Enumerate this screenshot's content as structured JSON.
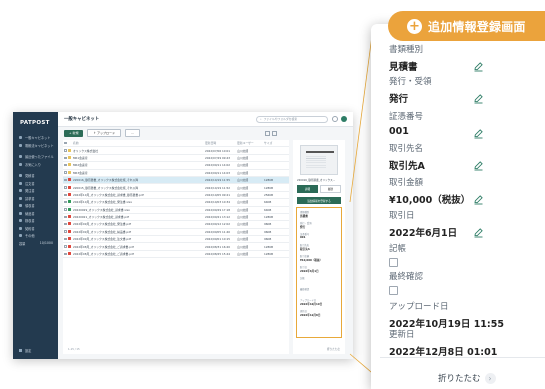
{
  "colors": {
    "accent": "#eba33c",
    "brand": "#2b6b57",
    "sidebar": "#233a4f",
    "selected_row": "#d7ebf5"
  },
  "app": {
    "logo": "PATPOST",
    "page_title": "一般キャビネット",
    "search_placeholder": "ファイルやフォルダを検索",
    "new_button": "新規",
    "upload_button": "アップロード",
    "sidebar": {
      "items": [
        "一般キャビネット",
        "電帳法キャビネット"
      ],
      "section_items": [
        "最近使ったファイル",
        "お気に入り"
      ],
      "categories": [
        "見積書",
        "注文書",
        "発注書",
        "請求書",
        "領収書",
        "納品書",
        "検収書",
        "契約書",
        "その他"
      ],
      "storage_label": "容量",
      "storage_value": "10/1000",
      "bottom": "設定"
    },
    "columns": [
      "名前",
      "更新日時",
      "更新ユーザー",
      "サイズ"
    ],
    "rows": [
      {
        "icon": "folder",
        "name": "オリックス株式会社",
        "date": "2022/07/06 10:01",
        "user": "山川太郎",
        "size": ""
      },
      {
        "icon": "folder",
        "name": "MR1会議室",
        "date": "2022/07/29 09:43",
        "user": "山川太郎",
        "size": ""
      },
      {
        "icon": "folder",
        "name": "MR2会議室",
        "date": "2022/09/11 14:02",
        "user": "山川太郎",
        "size": ""
      },
      {
        "icon": "folder",
        "name": "MR3会議室",
        "date": "2022/09/11 14:03",
        "user": "山川太郎",
        "size": ""
      },
      {
        "icon": "pdf",
        "name": "220016_御見積書_オリックス株式会社様_それ以降",
        "date": "2022/10/19 11:55",
        "user": "山川太郎",
        "size": "128KB",
        "selected": true
      },
      {
        "icon": "pdf",
        "name": "220015_御見積書_オリックス株式会社様_それ以降",
        "date": "2022/10/19 11:52",
        "user": "山川太郎",
        "size": "128KB"
      },
      {
        "icon": "pdf",
        "name": "2022年10月_オリックス株式会社_請求書_御見積書.pdf",
        "date": "2022/10/05 09:21",
        "user": "山川太郎",
        "size": "256KB"
      },
      {
        "icon": "xls",
        "name": "2022年10月_オリックス株式会社_発注書.xlsx",
        "date": "2022/10/03 10:34",
        "user": "山川太郎",
        "size": "64KB"
      },
      {
        "icon": "xls",
        "name": "20220929_オリックス株式会社_請求書.xlsx",
        "date": "2022/09/29 17:18",
        "user": "山川太郎",
        "size": "64KB"
      },
      {
        "icon": "pdf",
        "name": "20220921_オリックス株式会社_請求書.pdf",
        "date": "2022/09/21 13:12",
        "user": "山川太郎",
        "size": "128KB"
      },
      {
        "icon": "pdf",
        "name": "2022年09月_オリックス株式会社_発注書.pdf",
        "date": "2022/09/12 12:02",
        "user": "山川太郎",
        "size": "96KB"
      },
      {
        "icon": "pdf",
        "name": "2022年09月_オリックス株式会社_納品書.pdf",
        "date": "2022/09/05 11:40",
        "user": "山川太郎",
        "size": "96KB"
      },
      {
        "icon": "pdf",
        "name": "2022年09月_オリックス株式会社_注文書.pdf",
        "date": "2022/09/01 10:15",
        "user": "山川太郎",
        "size": "96KB"
      },
      {
        "icon": "pdf",
        "name": "2022年08月_オリックス株式会社_ご請求書.pdf",
        "date": "2022/08/31 16:20",
        "user": "山川太郎",
        "size": "128KB"
      },
      {
        "icon": "pdf",
        "name": "2022年08月_オリックス株式会社_ご請求書.pdf",
        "date": "2022/08/25 15:44",
        "user": "山川太郎",
        "size": "128KB"
      }
    ],
    "pager": "1-15 / 15",
    "preview": {
      "file_name": "220016_御見積書_オリックス...",
      "tabs": [
        "詳細",
        "履歴"
      ],
      "add_button": "追加情報を登録する",
      "fields": [
        {
          "k": "書類種別",
          "v": "見積書"
        },
        {
          "k": "発行・受領",
          "v": "発行"
        },
        {
          "k": "証憑番号",
          "v": "001"
        },
        {
          "k": "取引先名",
          "v": "取引先A"
        },
        {
          "k": "取引金額",
          "v": "¥10,000（税抜）"
        },
        {
          "k": "取引日",
          "v": "2022年6月1日"
        },
        {
          "k": "記帳",
          "v": ""
        },
        {
          "k": "最終確認",
          "v": ""
        },
        {
          "k": "アップロード日",
          "v": "2022年10月19日"
        },
        {
          "k": "更新日",
          "v": "2022年12月8日"
        }
      ],
      "fold": "折りたたむ"
    }
  },
  "panel": {
    "title": "追加情報登録画面",
    "fields": [
      {
        "key": "書類種別",
        "value": "見積書",
        "editable": true
      },
      {
        "key": "発行・受領",
        "value": "発行",
        "editable": true
      },
      {
        "key": "証憑番号",
        "value": "001",
        "editable": true
      },
      {
        "key": "取引先名",
        "value": "取引先A",
        "editable": true
      },
      {
        "key": "取引金額",
        "value": "¥10,000（税抜）",
        "editable": true
      },
      {
        "key": "取引日",
        "value": "2022年6月1日",
        "editable": true
      },
      {
        "key": "記帳",
        "value": "",
        "checkbox": true
      },
      {
        "key": "最終確認",
        "value": "",
        "checkbox": true
      },
      {
        "key": "アップロード日",
        "value": "2022年10月19日 11:55"
      },
      {
        "key": "更新日",
        "value": "2022年12月8日 01:01"
      }
    ],
    "fold_label": "折りたたむ",
    "fold_icon": "chevron-right-icon"
  }
}
